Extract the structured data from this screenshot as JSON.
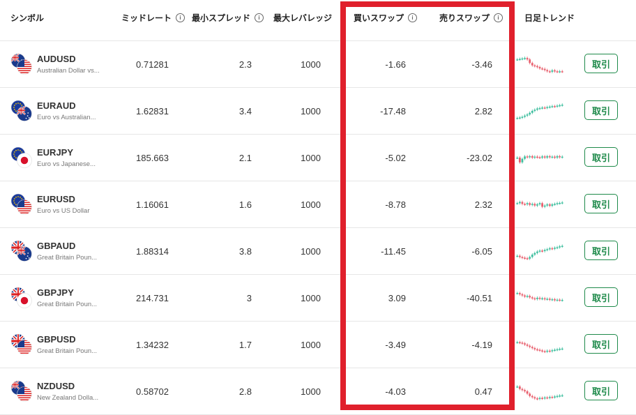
{
  "header": {
    "symbol": "シンボル",
    "mid_rate": "ミッドレート",
    "min_spread": "最小スプレッド",
    "max_leverage": "最大レバレッジ",
    "buy_swap": "買いスワップ",
    "sell_swap": "売りスワップ",
    "daily_trend": "日足トレンド",
    "info_glyph": "i"
  },
  "trade_label": "取引",
  "colors": {
    "up": "#3fbf9f",
    "down": "#e8606e",
    "highlight": "#e0202c",
    "button": "#1e8a4a"
  },
  "rows": [
    {
      "symbol": "AUDUSD",
      "desc": "Australian Dollar vs...",
      "mid": "0.71281",
      "spread": "2.3",
      "leverage": "1000",
      "buy": "-1.66",
      "sell": "-3.46",
      "flags": [
        "au",
        "us"
      ],
      "trend": [
        0.7,
        0.72,
        0.74,
        0.76,
        0.7,
        0.55,
        0.45,
        0.42,
        0.38,
        0.32,
        0.3,
        0.25,
        0.2,
        0.18,
        0.24,
        0.2,
        0.18,
        0.2,
        0.19
      ]
    },
    {
      "symbol": "EURAUD",
      "desc": "Euro vs Australian...",
      "mid": "1.62831",
      "spread": "3.4",
      "leverage": "1000",
      "buy": "-17.48",
      "sell": "2.82",
      "flags": [
        "eu",
        "au"
      ],
      "trend": [
        0.2,
        0.22,
        0.25,
        0.3,
        0.35,
        0.42,
        0.5,
        0.55,
        0.6,
        0.62,
        0.64,
        0.63,
        0.66,
        0.68,
        0.7,
        0.69,
        0.72,
        0.74,
        0.76
      ]
    },
    {
      "symbol": "EURJPY",
      "desc": "Euro vs Japanese...",
      "mid": "185.663",
      "spread": "2.1",
      "leverage": "1000",
      "buy": "-5.02",
      "sell": "-23.02",
      "flags": [
        "eu",
        "jp"
      ],
      "trend": [
        0.5,
        0.3,
        0.45,
        0.55,
        0.52,
        0.56,
        0.5,
        0.54,
        0.52,
        0.5,
        0.55,
        0.5,
        0.56,
        0.52,
        0.54,
        0.5,
        0.56,
        0.52,
        0.54
      ]
    },
    {
      "symbol": "EURUSD",
      "desc": "Euro vs US Dollar",
      "mid": "1.16061",
      "spread": "1.6",
      "leverage": "1000",
      "buy": "-8.78",
      "sell": "2.32",
      "flags": [
        "eu",
        "us"
      ],
      "trend": [
        0.55,
        0.6,
        0.52,
        0.5,
        0.55,
        0.48,
        0.52,
        0.45,
        0.5,
        0.55,
        0.4,
        0.45,
        0.5,
        0.44,
        0.5,
        0.52,
        0.55,
        0.56,
        0.58
      ]
    },
    {
      "symbol": "GBPAUD",
      "desc": "Great Britain Poun...",
      "mid": "1.88314",
      "spread": "3.8",
      "leverage": "1000",
      "buy": "-11.45",
      "sell": "-6.05",
      "flags": [
        "gb",
        "au"
      ],
      "trend": [
        0.3,
        0.25,
        0.22,
        0.2,
        0.18,
        0.25,
        0.35,
        0.42,
        0.48,
        0.52,
        0.5,
        0.55,
        0.58,
        0.62,
        0.6,
        0.64,
        0.66,
        0.7,
        0.72
      ]
    },
    {
      "symbol": "GBPJPY",
      "desc": "Great Britain Poun...",
      "mid": "214.731",
      "spread": "3",
      "leverage": "1000",
      "buy": "3.09",
      "sell": "-40.51",
      "flags": [
        "gb",
        "jp"
      ],
      "trend": [
        0.7,
        0.65,
        0.6,
        0.55,
        0.58,
        0.52,
        0.48,
        0.45,
        0.5,
        0.46,
        0.48,
        0.44,
        0.46,
        0.42,
        0.44,
        0.4,
        0.42,
        0.4,
        0.41
      ]
    },
    {
      "symbol": "GBPUSD",
      "desc": "Great Britain Poun...",
      "mid": "1.34232",
      "spread": "1.7",
      "leverage": "1000",
      "buy": "-3.49",
      "sell": "-4.19",
      "flags": [
        "gb",
        "us"
      ],
      "trend": [
        0.6,
        0.58,
        0.55,
        0.5,
        0.45,
        0.4,
        0.35,
        0.3,
        0.28,
        0.25,
        0.22,
        0.2,
        0.24,
        0.22,
        0.26,
        0.28,
        0.3,
        0.32,
        0.33
      ]
    },
    {
      "symbol": "NZDUSD",
      "desc": "New Zealand Dolla...",
      "mid": "0.58702",
      "spread": "2.8",
      "leverage": "1000",
      "buy": "-4.03",
      "sell": "0.47",
      "flags": [
        "nz",
        "us"
      ],
      "trend": [
        0.7,
        0.6,
        0.55,
        0.5,
        0.4,
        0.3,
        0.25,
        0.2,
        0.18,
        0.22,
        0.2,
        0.24,
        0.22,
        0.26,
        0.25,
        0.28,
        0.3,
        0.32,
        0.33
      ]
    }
  ]
}
